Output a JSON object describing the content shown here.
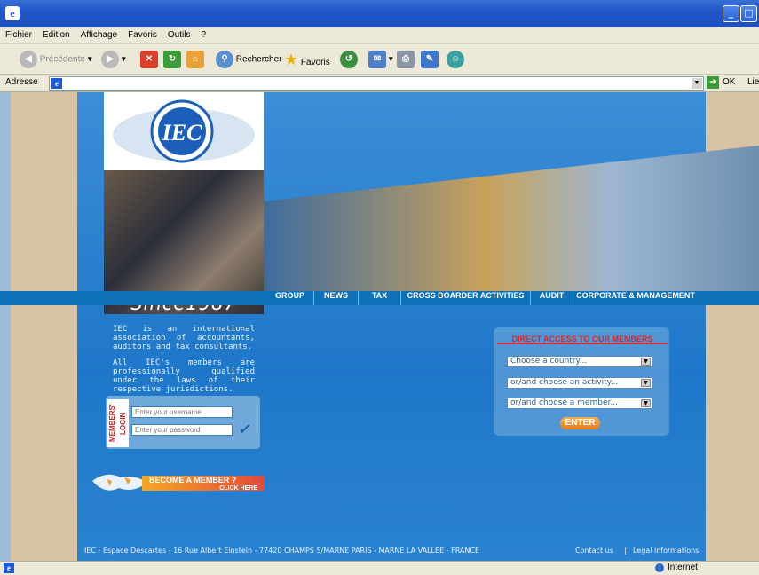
{
  "menu": [
    "Fichier",
    "Edition",
    "Affichage",
    "Favoris",
    "Outils",
    "?"
  ],
  "toolbar": {
    "back": "Précédente",
    "search": "Rechercher",
    "favorites": "Favoris"
  },
  "address": {
    "label": "Adresse",
    "go": "OK",
    "links": "Lie"
  },
  "status": {
    "zone": "Internet"
  },
  "site": {
    "logo": "IEC",
    "since": "Since1987",
    "nav": [
      "GROUP",
      "NEWS",
      "TAX",
      "CROSS BOARDER ACTIVITIES",
      "AUDIT",
      "CORPORATE & MANAGEMENT"
    ],
    "intro1": "IEC is an international association of accountants, auditors and tax consultants.",
    "intro2": "All IEC's members are professionally qualified under the laws of their respective jurisdictions.",
    "login_label": "MEMBERS' LOGIN",
    "username_placeholder": "Enter your username",
    "password_placeholder": "Enter your password",
    "become_member": "BECOME A MEMBER ?",
    "click_here": "CLICK HERE",
    "direct_title": "DIRECT ACCESS TO OUR MEMBERS",
    "select_country": "Choose a country...",
    "select_activity": "or/and choose an activity...",
    "select_member": "or/and choose a member...",
    "enter": "ENTER",
    "footer_address": "IEC - Espace Descartes - 16 Rue Albert Einstein - 77420 CHAMPS S/MARNE PARIS - MARNE LA VALLEE - FRANCE",
    "contact": "Contact us",
    "legal": "Legal informations"
  }
}
